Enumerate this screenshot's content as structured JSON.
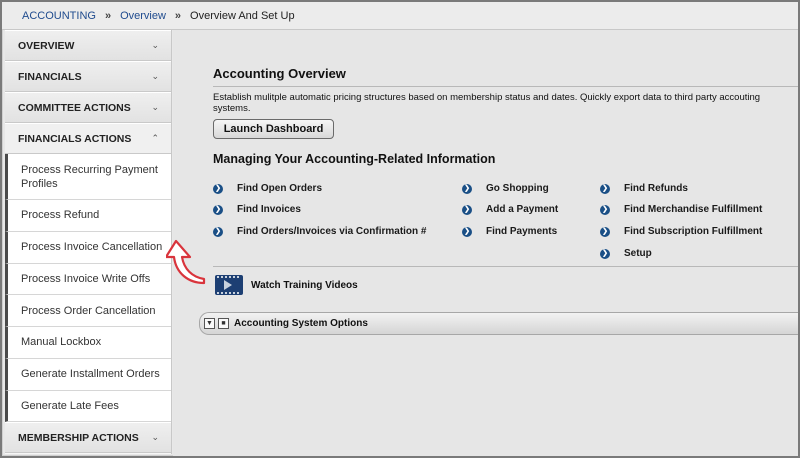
{
  "breadcrumb": {
    "items": [
      "ACCOUNTING",
      "Overview"
    ],
    "separator": "»",
    "current": "Overview And Set Up"
  },
  "sidebar": {
    "sections": [
      {
        "label": "OVERVIEW",
        "chevron": "chevron-down"
      },
      {
        "label": "FINANCIALS",
        "chevron": "chevron-down"
      },
      {
        "label": "COMMITTEE ACTIONS",
        "chevron": "chevron-down"
      },
      {
        "label": "FINANCIALS ACTIONS",
        "chevron": "chevron-up"
      }
    ],
    "items": [
      "Process Recurring Payment Profiles",
      "Process Refund",
      "Process Invoice Cancellation",
      "Process Invoice Write Offs",
      "Process Order Cancellation",
      "Manual Lockbox",
      "Generate Installment Orders",
      "Generate Late Fees"
    ],
    "bottom_section": {
      "label": "MEMBERSHIP ACTIONS",
      "chevron": "chevron-down"
    }
  },
  "main": {
    "title": "Accounting Overview",
    "description": "Establish mulitple automatic pricing structures based on membership status and dates. Quickly export data to third party accouting systems.",
    "launch_button": "Launch Dashboard",
    "subtitle": "Managing Your Accounting-Related Information",
    "links_col1": [
      "Find Open Orders",
      "Find Invoices",
      "Find Orders/Invoices via Confirmation #"
    ],
    "links_col2": [
      "Go Shopping",
      "Add a Payment",
      "Find Payments"
    ],
    "links_col3": [
      "Find Refunds",
      "Find Merchandise Fulfillment",
      "Find Subscription Fulfillment",
      "Setup"
    ],
    "training_label": "Watch Training Videos",
    "options_label": "Accounting System Options"
  },
  "colors": {
    "link": "#1f4b8e",
    "bullet": "#1a4f86",
    "arrow": "#d9343c"
  }
}
